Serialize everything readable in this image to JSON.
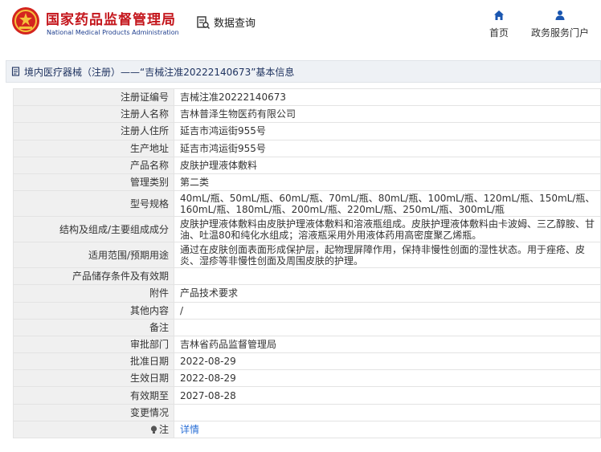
{
  "header": {
    "brand_cn": "国家药品监督管理局",
    "brand_en": "National Medical Products Administration",
    "query_label": "数据查询",
    "nav": [
      {
        "label": "首页",
        "icon": "home-icon"
      },
      {
        "label": "政务服务门户",
        "icon": "user-icon"
      }
    ]
  },
  "breadcrumb": "境内医疗器械（注册）——“吉械注准20222140673”基本信息",
  "rows": [
    {
      "label": "注册证编号",
      "value": "吉械注准20222140673"
    },
    {
      "label": "注册人名称",
      "value": "吉林普泽生物医药有限公司"
    },
    {
      "label": "注册人住所",
      "value": "延吉市鸿运街955号"
    },
    {
      "label": "生产地址",
      "value": "延吉市鸿运街955号"
    },
    {
      "label": "产品名称",
      "value": "皮肤护理液体敷料"
    },
    {
      "label": "管理类别",
      "value": "第二类"
    },
    {
      "label": "型号规格",
      "value": "40mL/瓶、50mL/瓶、60mL/瓶、70mL/瓶、80mL/瓶、100mL/瓶、120mL/瓶、150mL/瓶、160mL/瓶、180mL/瓶、200mL/瓶、220mL/瓶、250mL/瓶、300mL/瓶"
    },
    {
      "label": "结构及组成/主要组成成分",
      "value": "皮肤护理液体敷料由皮肤护理液体敷料和溶液瓶组成。皮肤护理液体敷料由卡波姆、三乙醇胺、甘油、吐温80和纯化水组成；溶液瓶采用外用液体药用高密度聚乙烯瓶。"
    },
    {
      "label": "适用范围/预期用途",
      "value": "通过在皮肤创面表面形成保护层，起物理屏障作用，保持非慢性创面的湿性状态。用于痤疮、皮炎、湿疹等非慢性创面及周围皮肤的护理。"
    },
    {
      "label": "产品储存条件及有效期",
      "value": ""
    },
    {
      "label": "附件",
      "value": "产品技术要求"
    },
    {
      "label": "其他内容",
      "value": "/"
    },
    {
      "label": "备注",
      "value": ""
    },
    {
      "label": "审批部门",
      "value": "吉林省药品监督管理局"
    },
    {
      "label": "批准日期",
      "value": "2022-08-29"
    },
    {
      "label": "生效日期",
      "value": "2022-08-29"
    },
    {
      "label": "有效期至",
      "value": "2027-08-28"
    },
    {
      "label": "变更情况",
      "value": ""
    }
  ],
  "note_row": {
    "label": "注",
    "link": "详情"
  },
  "colors": {
    "brand_red": "#c4161c",
    "brand_blue": "#1f3f8f",
    "nav_blue": "#1a56b0",
    "link": "#2a6fd6"
  }
}
